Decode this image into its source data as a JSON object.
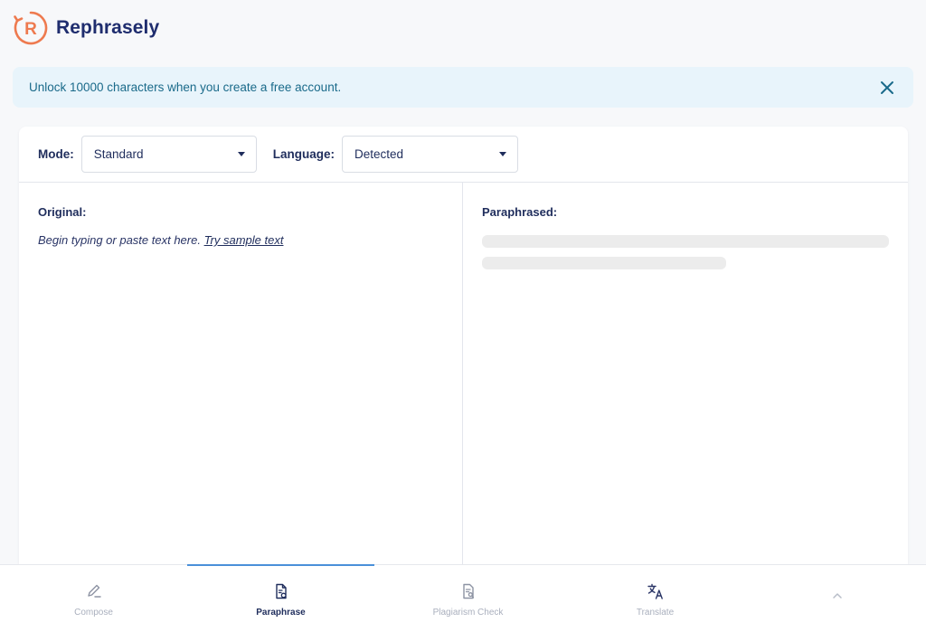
{
  "brand": {
    "name": "Rephrasely",
    "logo_letter": "R",
    "logo_color": "#ee7a4f"
  },
  "banner": {
    "text": "Unlock 10000 characters when you create a free account.",
    "close_icon": "close-icon"
  },
  "toolbar": {
    "mode_label": "Mode:",
    "mode_value": "Standard",
    "language_label": "Language:",
    "language_value": "Detected"
  },
  "original": {
    "title": "Original:",
    "placeholder": "Begin typing or paste text here.",
    "sample_link": "Try sample text"
  },
  "paraphrased": {
    "title": "Paraphrased:"
  },
  "nav": {
    "items": [
      {
        "label": "Compose",
        "icon": "pencil-icon",
        "active": false
      },
      {
        "label": "Paraphrase",
        "icon": "paraphrase-document-icon",
        "active": true
      },
      {
        "label": "Plagiarism Check",
        "icon": "plagiarism-document-icon",
        "active": false
      },
      {
        "label": "Translate",
        "icon": "translate-icon",
        "active": false
      }
    ],
    "collapse_icon": "chevron-up-icon"
  },
  "colors": {
    "accent": "#4a90d9",
    "brand_navy": "#1f2d6e",
    "banner_bg": "#e8f4fb",
    "banner_text": "#1a6a8a"
  }
}
